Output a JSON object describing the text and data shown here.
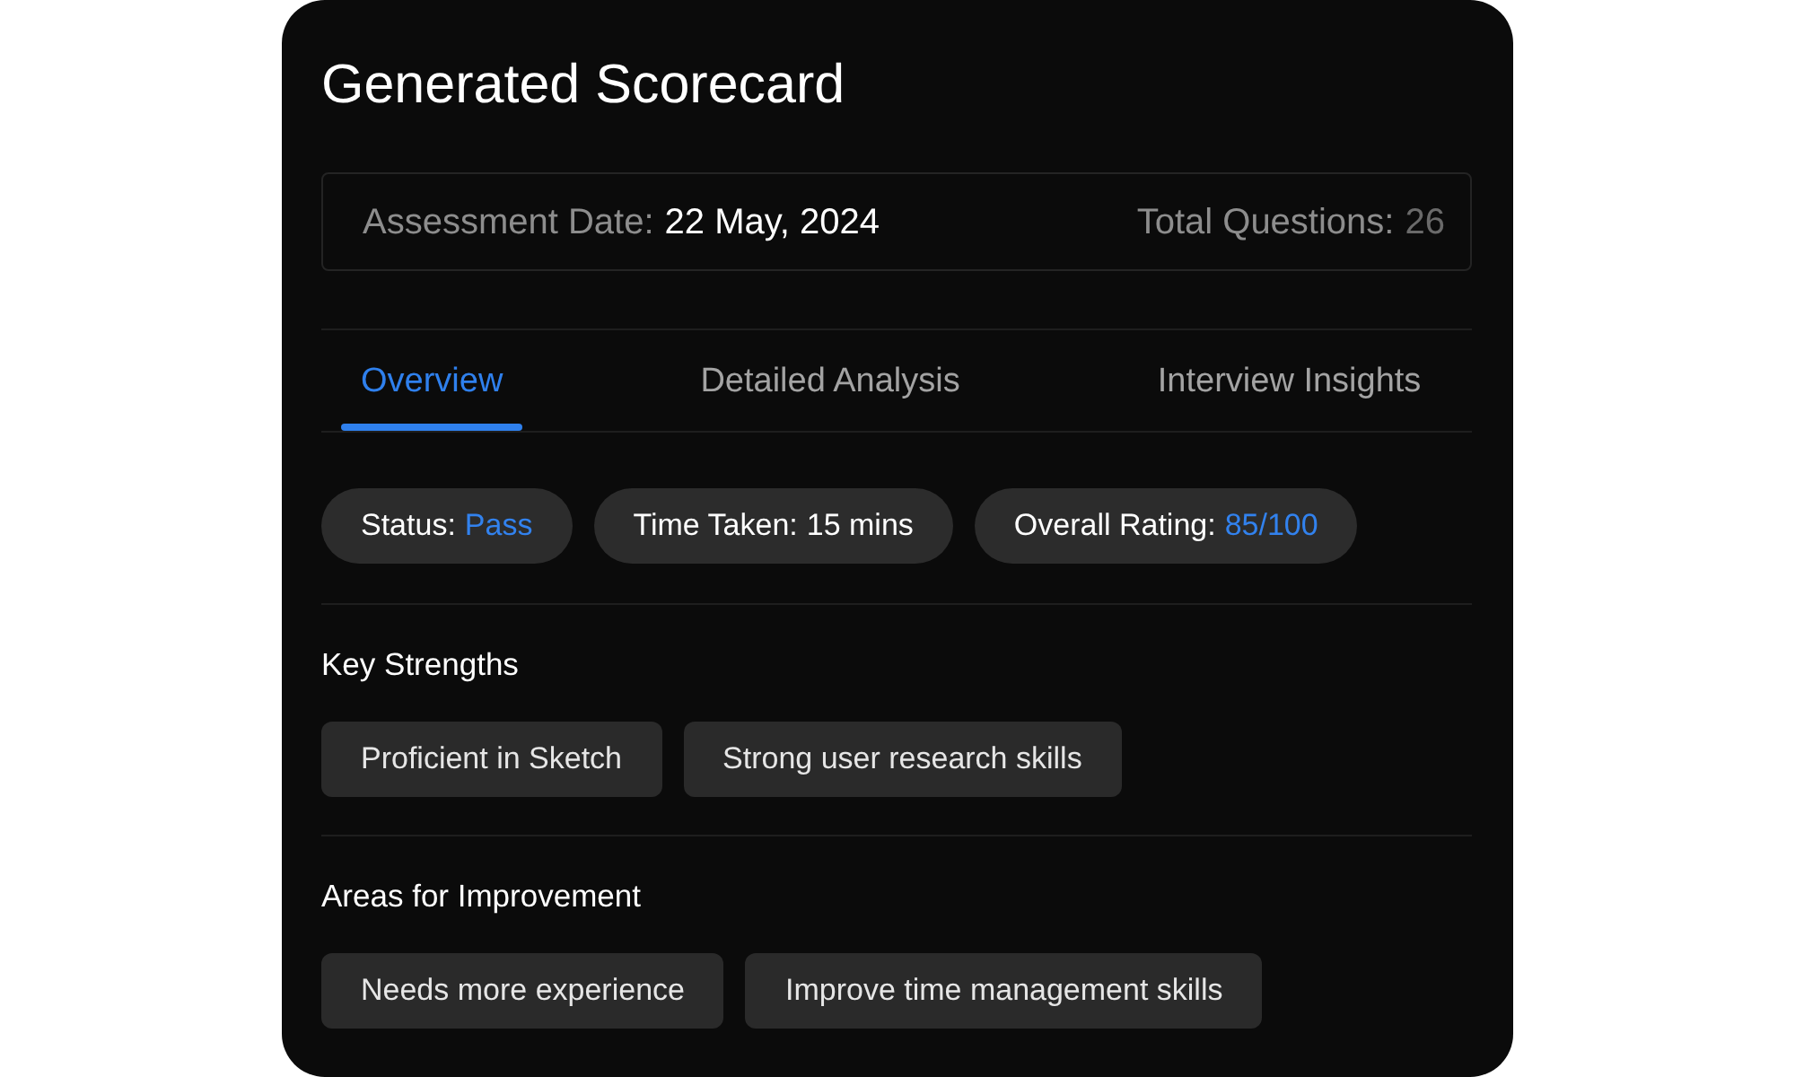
{
  "title": "Generated Scorecard",
  "summary": [
    {
      "label": "Assessment Date:",
      "value": "22 May, 2024",
      "dimmed": false
    },
    {
      "label": "Total Questions:",
      "value": "26",
      "dimmed": true
    }
  ],
  "tabs": [
    {
      "label": "Overview",
      "selected": true
    },
    {
      "label": "Detailed Analysis",
      "selected": false
    },
    {
      "label": "Interview Insights",
      "selected": false
    }
  ],
  "stats": [
    {
      "label": "Status:",
      "value": "Pass",
      "highlight": true
    },
    {
      "label": "Time Taken:",
      "value": "15 mins",
      "highlight": false
    },
    {
      "label": "Overall Rating:",
      "value": "85/100",
      "highlight": true
    }
  ],
  "sections": [
    {
      "heading": "Key Strengths",
      "items": [
        "Proficient in Sketch",
        "Strong user research skills"
      ]
    },
    {
      "heading": "Areas for Improvement",
      "items": [
        "Needs more experience",
        "Improve time management skills"
      ]
    }
  ]
}
